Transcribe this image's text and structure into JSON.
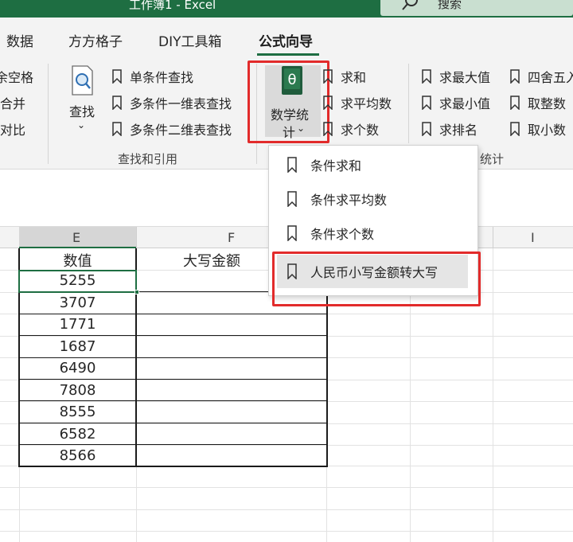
{
  "window": {
    "title": "工作簿1  -  Excel",
    "search_placeholder": "搜索",
    "accent": "#1e6e42",
    "highlight": "#e22b2b"
  },
  "tabs": [
    "数据",
    "方方格子",
    "DIY工具箱",
    "公式向导"
  ],
  "active_tab": "公式向导",
  "ribbon": {
    "left_partial": [
      "余空格",
      "合并",
      "对比"
    ],
    "lookup_group": {
      "big_button": "查找",
      "items": [
        "单条件查找",
        "多条件一维表查找",
        "多条件二维表查找"
      ],
      "label": "查找和引用"
    },
    "math_button": {
      "line1": "数学统",
      "line2": "计",
      "icon_glyph": "θ"
    },
    "sum_items": [
      "求和",
      "求平均数",
      "求个数"
    ],
    "stat_items": [
      "求最大值",
      "求最小值",
      "求排名"
    ],
    "round_items": [
      "四舍五入",
      "取整数",
      "取小数"
    ],
    "stat_group_label": "统计"
  },
  "dropdown": {
    "items": [
      "条件求和",
      "条件求平均数",
      "条件求个数",
      "人民币小写金额转大写"
    ],
    "hovered_index": 3
  },
  "sheet": {
    "columns": [
      "E",
      "F",
      "I"
    ],
    "header_e": "数值",
    "header_f": "大写金额",
    "values": [
      "5255",
      "3707",
      "1771",
      "1687",
      "6490",
      "7808",
      "8555",
      "6582",
      "8566"
    ]
  }
}
